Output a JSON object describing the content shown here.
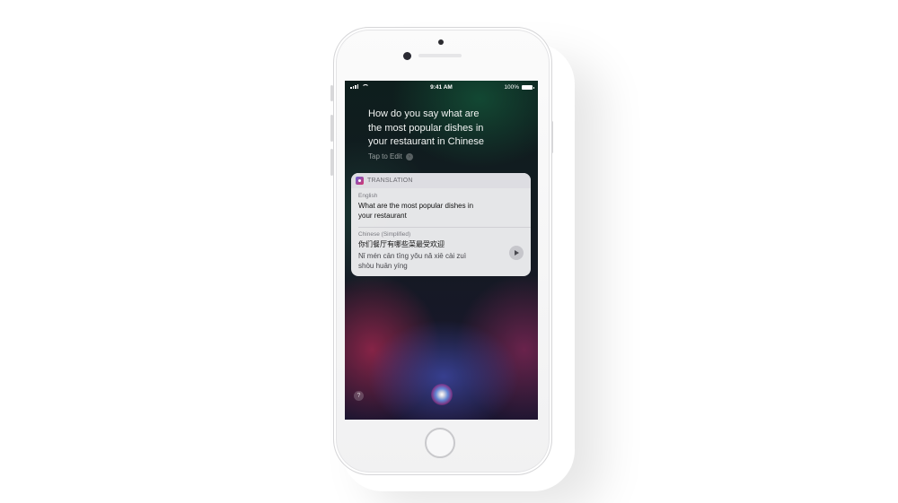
{
  "status_bar": {
    "time": "9:41 AM",
    "battery": "100%"
  },
  "siri": {
    "query_lines": [
      "How do you say what are",
      "the most popular dishes in",
      "your restaurant in Chinese"
    ],
    "tap_to_edit": "Tap to Edit",
    "help_label": "?"
  },
  "translation_card": {
    "title": "TRANSLATION",
    "source_language": "English",
    "source_text_lines": [
      "What are the most popular dishes in",
      "your restaurant"
    ],
    "target_language": "Chinese (Simplified)",
    "target_text": "你们餐厅有哪些菜最受欢迎",
    "pinyin_lines": [
      "Nǐ mén cān tīng yǒu nǎ xiē cài zuì",
      "shòu huān yíng"
    ]
  },
  "icons": {
    "app": "translation-app-icon",
    "play": "play-icon",
    "siri": "siri-orb-icon"
  }
}
